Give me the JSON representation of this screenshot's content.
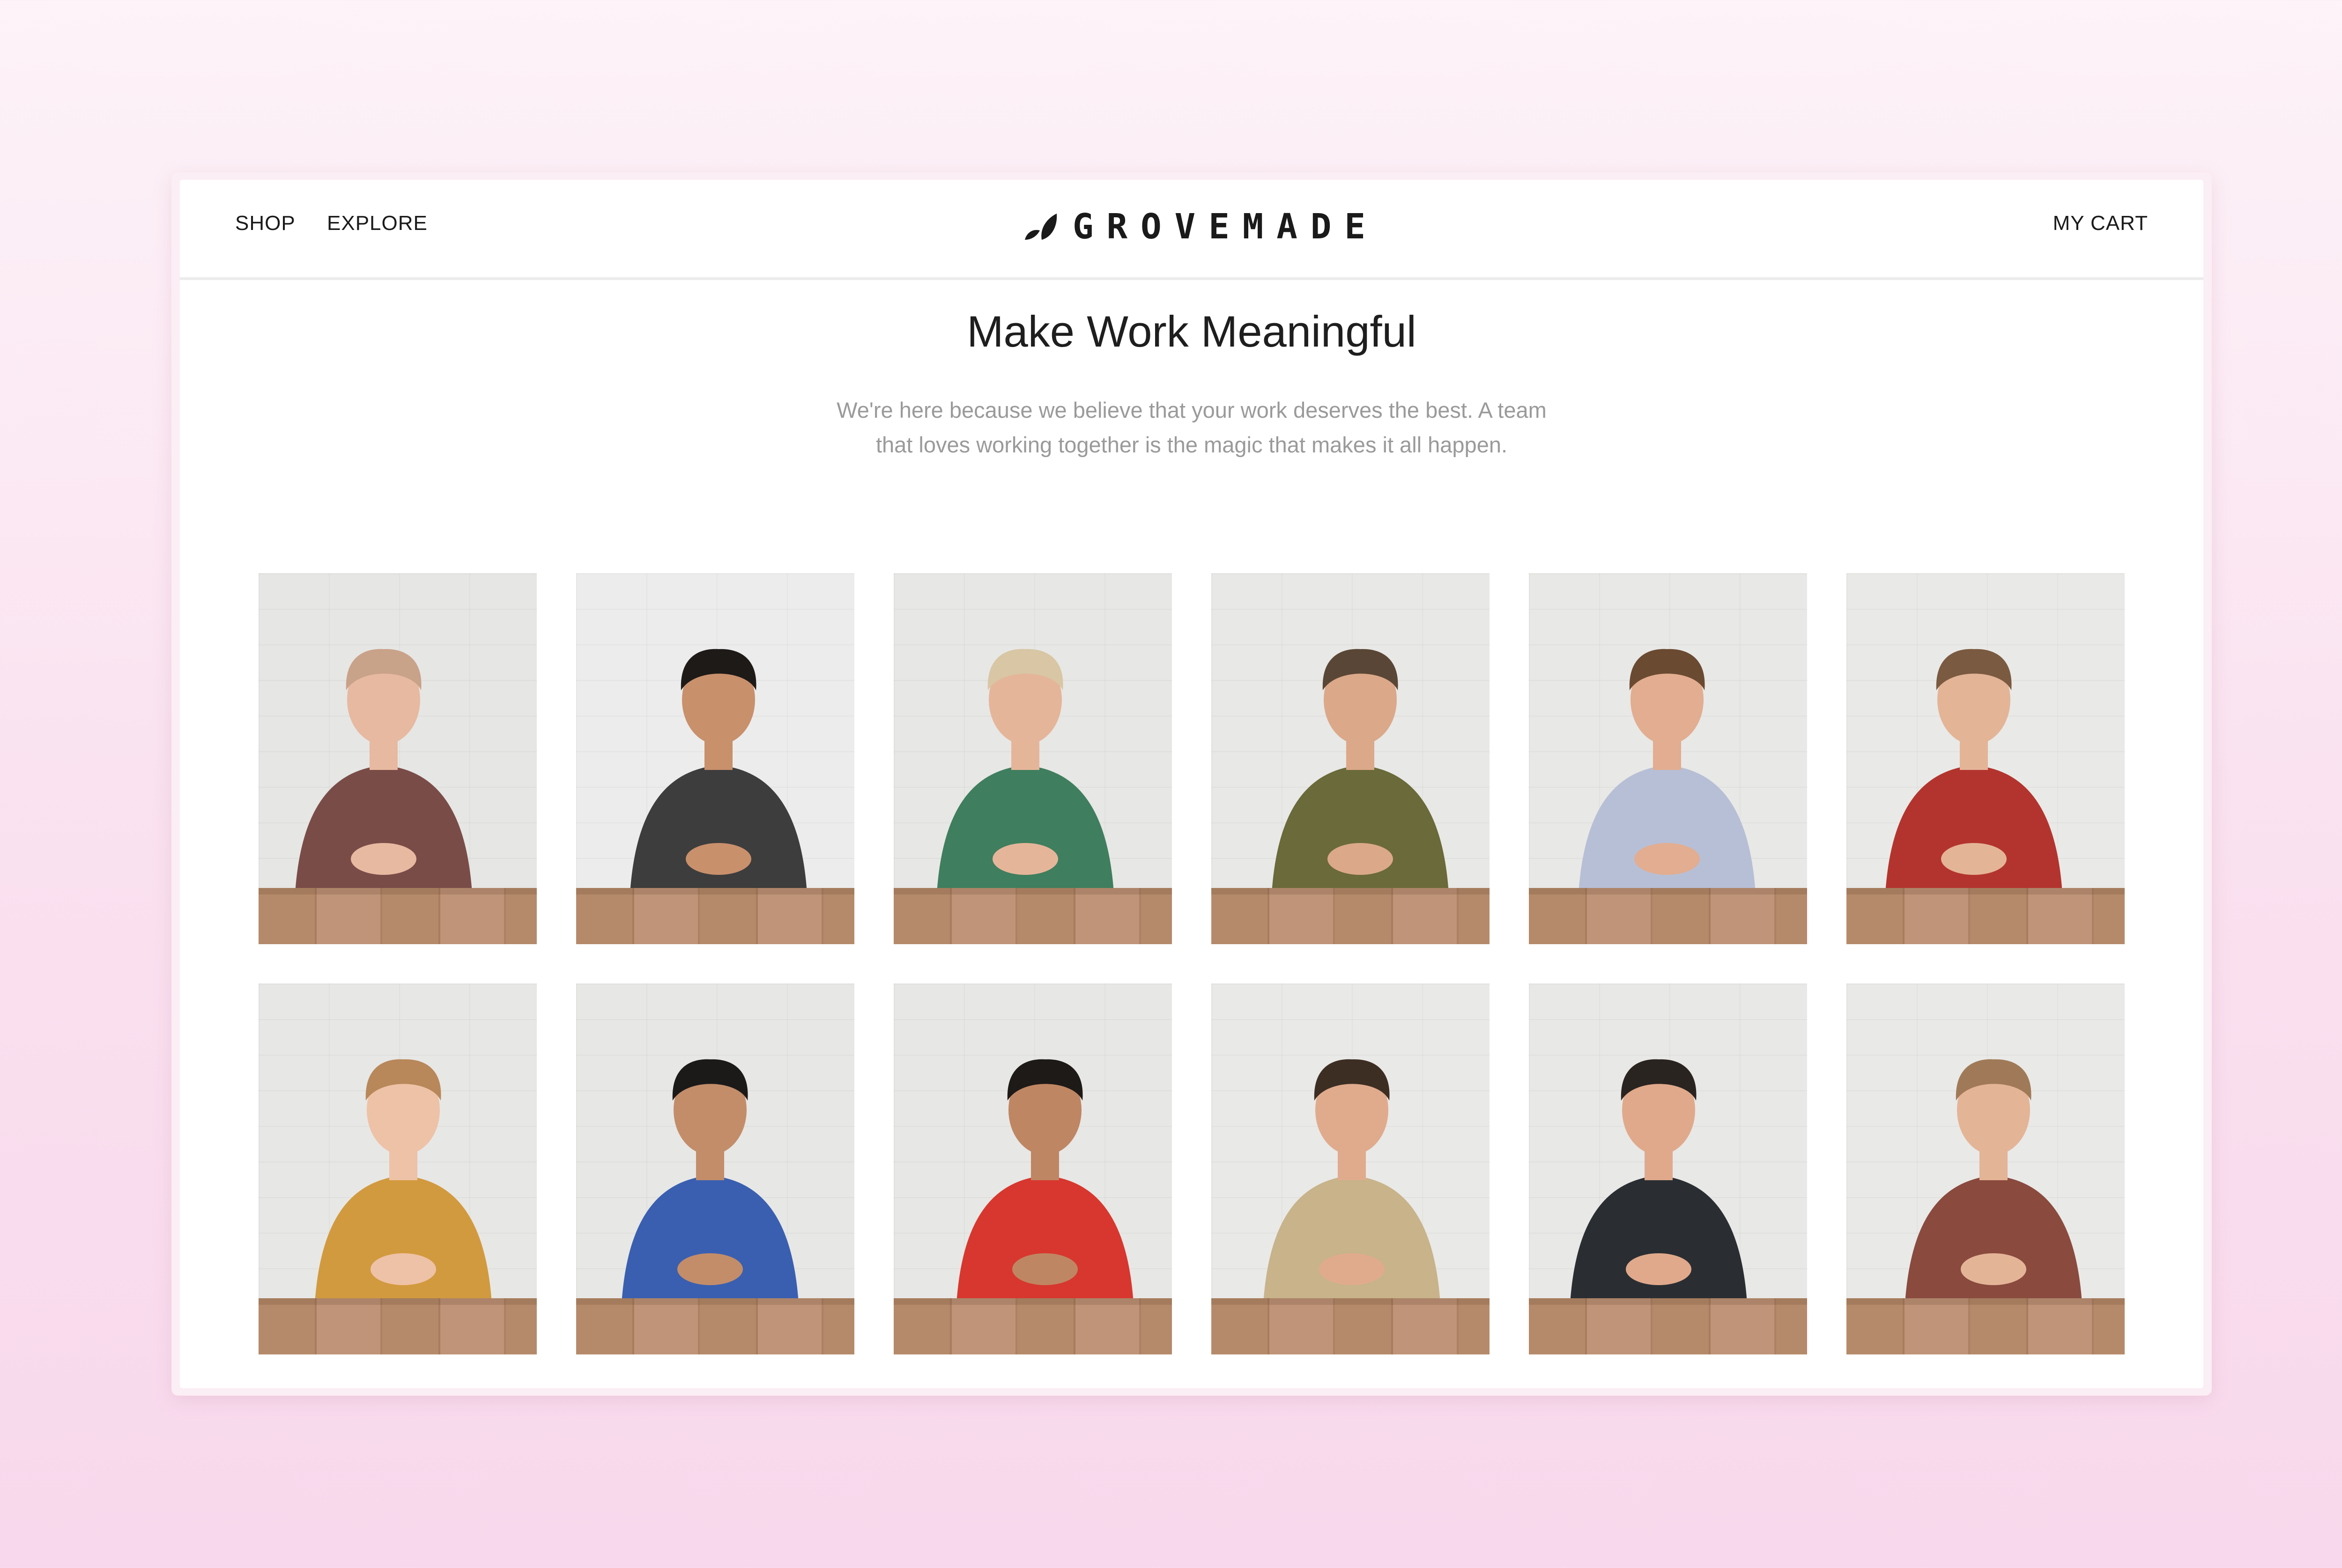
{
  "nav": {
    "shop": "SHOP",
    "explore": "EXPLORE",
    "cart": "MY CART"
  },
  "brand": {
    "name": "GROVEMADE"
  },
  "hero": {
    "title": "Make Work Meaningful",
    "line1": "We're here because we believe that your work deserves the best. A team",
    "line2": "that loves working together is the magic that makes it all happen."
  },
  "team": [
    {
      "wall": "#e6e6e4",
      "shirt": "#7a4c48",
      "skin": "#e7b9a0",
      "hair": "#c9a28a"
    },
    {
      "wall": "#ececec",
      "shirt": "#3d3d3d",
      "skin": "#c9906c",
      "hair": "#1e1a18"
    },
    {
      "wall": "#e7e7e5",
      "shirt": "#3f7e5e",
      "skin": "#e5b59a",
      "hair": "#d8c6a4"
    },
    {
      "wall": "#e8e8e6",
      "shirt": "#6a6a3a",
      "skin": "#dba88a",
      "hair": "#5a4636"
    },
    {
      "wall": "#e8e8e6",
      "shirt": "#b7bfd6",
      "skin": "#e2ad90",
      "hair": "#6b4a32"
    },
    {
      "wall": "#e9e9e7",
      "shirt": "#b3342e",
      "skin": "#e4b497",
      "hair": "#7a5a40"
    },
    {
      "wall": "#e7e7e5",
      "shirt": "#d29a3e",
      "skin": "#eec2a6",
      "hair": "#b8875a"
    },
    {
      "wall": "#e7e7e5",
      "shirt": "#3a5fb0",
      "skin": "#c38d6a",
      "hair": "#1c1a19"
    },
    {
      "wall": "#e7e7e5",
      "shirt": "#d7372e",
      "skin": "#bf8663",
      "hair": "#1d1a18"
    },
    {
      "wall": "#e9e9e7",
      "shirt": "#c8b38a",
      "skin": "#e0ab8c",
      "hair": "#3d2e24"
    },
    {
      "wall": "#e8e8e6",
      "shirt": "#2a2e33",
      "skin": "#e0a98b",
      "hair": "#2a2420"
    },
    {
      "wall": "#e9e9e7",
      "shirt": "#8a4a3e",
      "skin": "#e4b497",
      "hair": "#a07a58"
    }
  ],
  "colors": {
    "table": "#b58a6a",
    "text": "#1a1a1a",
    "muted": "#9a9a9a"
  }
}
